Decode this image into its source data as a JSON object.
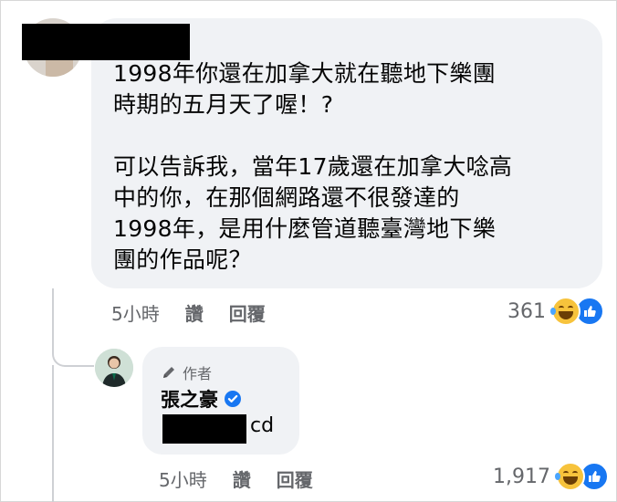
{
  "top_comment": {
    "text": "1998年你還在加拿大就在聽地下樂團\n時期的五月天了喔！?\n\n可以告訴我，當年17歲還在加拿大唸高\n中的你，在那個網路還不很發達的\n1998年，是用什麼管道聽臺灣地下樂\n團的作品呢？",
    "time": "5小時",
    "like_label": "讚",
    "reply_label": "回覆",
    "reaction_count": "361",
    "reaction_icons": [
      "laugh-emoji",
      "like-thumb"
    ]
  },
  "reply": {
    "author_badge": "作者",
    "author_name": "張之豪",
    "text_suffix": "cd",
    "time": "5小時",
    "like_label": "讚",
    "reply_label": "回覆",
    "reaction_count": "1,917",
    "reaction_icons": [
      "laugh-emoji",
      "like-thumb"
    ]
  },
  "colors": {
    "bubble": "#f0f2f5",
    "meta_text": "#65676b",
    "like_blue": "#1877f2",
    "laugh_yellow": "#f7c33c"
  }
}
